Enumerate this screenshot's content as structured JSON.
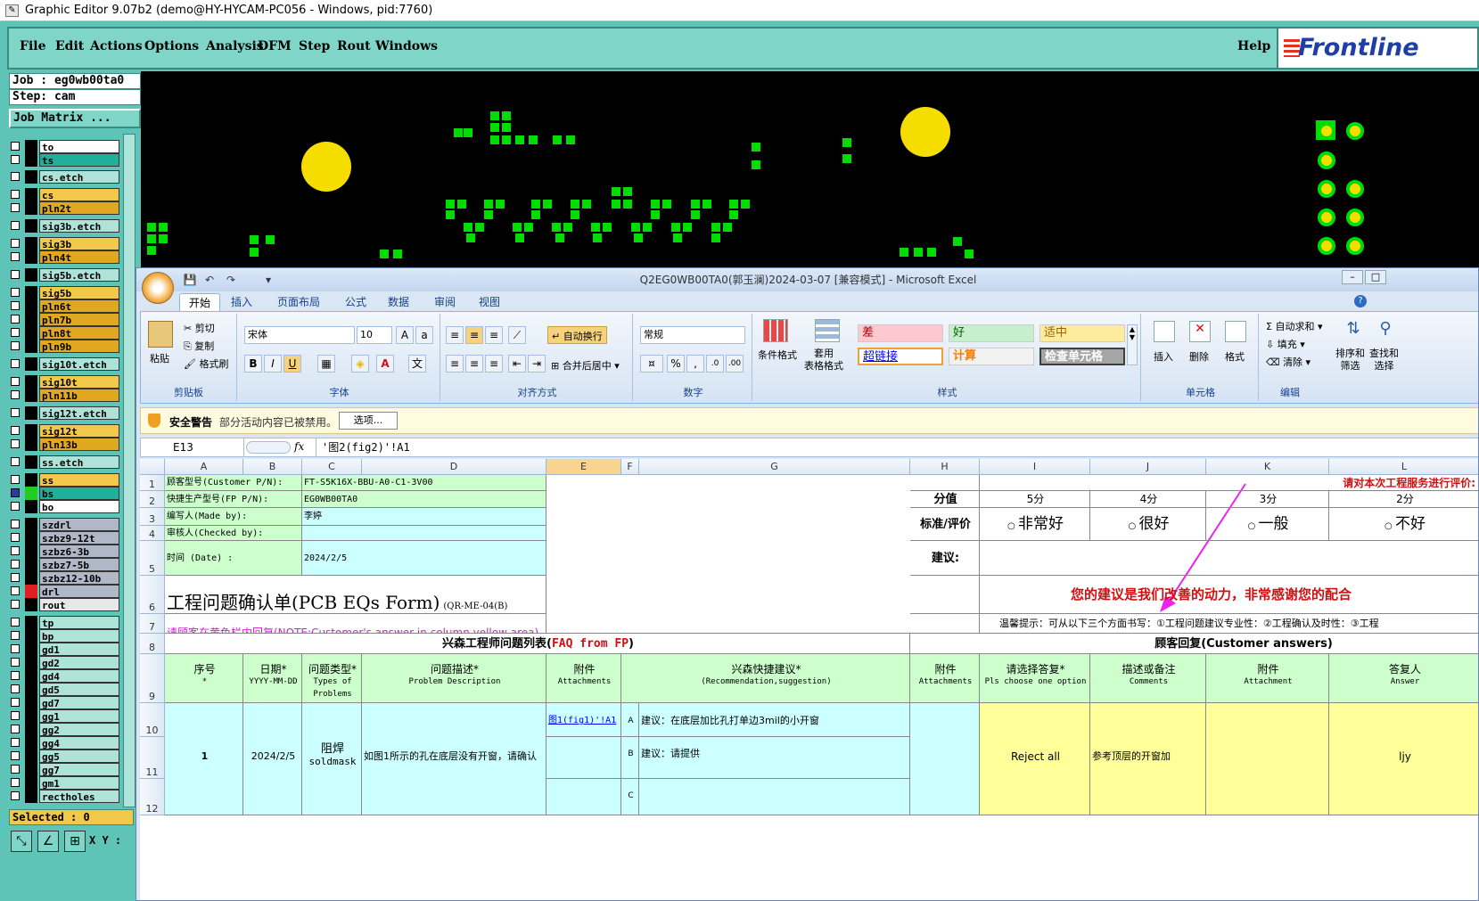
{
  "app": {
    "title": "Graphic Editor 9.07b2 (demo@HY-HYCAM-PC056 - Windows, pid:7760)",
    "logo": "Frontline"
  },
  "menu": [
    "File",
    "Edit",
    "Actions",
    "Options",
    "Analysis",
    "DFM",
    "Step",
    "Rout",
    "Windows"
  ],
  "help": "Help",
  "job": {
    "job": "Job : eg0wb00ta0",
    "step": "Step: cam",
    "matrix_btn": "Job Matrix ..."
  },
  "layers": [
    {
      "name": "to",
      "color": "#ffffff",
      "sw": "#000000"
    },
    {
      "name": "ts",
      "color": "#1fb09c",
      "sw": "#000000"
    },
    {
      "name": "cs.etch",
      "color": "#aee3da",
      "sw": "#000000"
    },
    {
      "name": "cs",
      "color": "#f2c84b",
      "sw": "#000000"
    },
    {
      "name": "pln2t",
      "color": "#e0a820",
      "sw": "#000000"
    },
    {
      "name": "sig3b.etch",
      "color": "#aee3da",
      "sw": "#000000"
    },
    {
      "name": "sig3b",
      "color": "#f2c84b",
      "sw": "#000000"
    },
    {
      "name": "pln4t",
      "color": "#e0a820",
      "sw": "#000000"
    },
    {
      "name": "sig5b.etch",
      "color": "#aee3da",
      "sw": "#000000"
    },
    {
      "name": "sig5b",
      "color": "#f2c84b",
      "sw": "#000000"
    },
    {
      "name": "pln6t",
      "color": "#e0a820",
      "sw": "#000000"
    },
    {
      "name": "pln7b",
      "color": "#e0a820",
      "sw": "#000000"
    },
    {
      "name": "pln8t",
      "color": "#e0a820",
      "sw": "#000000"
    },
    {
      "name": "pln9b",
      "color": "#e0a820",
      "sw": "#000000"
    },
    {
      "name": "sig10t.etch",
      "color": "#aee3da",
      "sw": "#000000"
    },
    {
      "name": "sig10t",
      "color": "#f2c84b",
      "sw": "#000000"
    },
    {
      "name": "pln11b",
      "color": "#e0a820",
      "sw": "#000000"
    },
    {
      "name": "sig12t.etch",
      "color": "#aee3da",
      "sw": "#000000"
    },
    {
      "name": "sig12t",
      "color": "#f2c84b",
      "sw": "#000000"
    },
    {
      "name": "pln13b",
      "color": "#e0a820",
      "sw": "#000000"
    },
    {
      "name": "ss.etch",
      "color": "#aee3da",
      "sw": "#000000"
    },
    {
      "name": "ss",
      "color": "#f2c84b",
      "sw": "#000000"
    },
    {
      "name": "bs",
      "color": "#1fb09c",
      "sw": "#22cc22"
    },
    {
      "name": "bo",
      "color": "#ffffff",
      "sw": "#000000"
    },
    {
      "name": "szdrl",
      "color": "#b0b8c8",
      "sw": "#000000"
    },
    {
      "name": "szbz9-12t",
      "color": "#b0b8c8",
      "sw": "#000000"
    },
    {
      "name": "szbz6-3b",
      "color": "#b0b8c8",
      "sw": "#000000"
    },
    {
      "name": "szbz7-5b",
      "color": "#b0b8c8",
      "sw": "#000000"
    },
    {
      "name": "szbz12-10b",
      "color": "#b0b8c8",
      "sw": "#000000"
    },
    {
      "name": "drl",
      "color": "#b0b8c8",
      "sw": "#e02020"
    },
    {
      "name": "rout",
      "color": "#e8e8e8",
      "sw": "#000000"
    },
    {
      "name": "tp",
      "color": "#aee3da",
      "sw": "#000000"
    },
    {
      "name": "bp",
      "color": "#aee3da",
      "sw": "#000000"
    },
    {
      "name": "gd1",
      "color": "#aee3da",
      "sw": "#000000"
    },
    {
      "name": "gd2",
      "color": "#aee3da",
      "sw": "#000000"
    },
    {
      "name": "gd4",
      "color": "#aee3da",
      "sw": "#000000"
    },
    {
      "name": "gd5",
      "color": "#aee3da",
      "sw": "#000000"
    },
    {
      "name": "gd7",
      "color": "#aee3da",
      "sw": "#000000"
    },
    {
      "name": "gg1",
      "color": "#aee3da",
      "sw": "#000000"
    },
    {
      "name": "gg2",
      "color": "#aee3da",
      "sw": "#000000"
    },
    {
      "name": "gg4",
      "color": "#aee3da",
      "sw": "#000000"
    },
    {
      "name": "gg5",
      "color": "#aee3da",
      "sw": "#000000"
    },
    {
      "name": "gg7",
      "color": "#aee3da",
      "sw": "#000000"
    },
    {
      "name": "gm1",
      "color": "#aee3da",
      "sw": "#000000"
    },
    {
      "name": "rectholes",
      "color": "#aee3da",
      "sw": "#000000"
    }
  ],
  "selected": "Selected : 0",
  "xy": "X Y :",
  "excel": {
    "title": "Q2EG0WB00TA0(郭玉澜)2024-03-07 [兼容模式] - Microsoft Excel",
    "tabs": [
      "开始",
      "插入",
      "页面布局",
      "公式",
      "数据",
      "审阅",
      "视图"
    ],
    "clipboard": {
      "paste": "粘贴",
      "cut": "剪切",
      "copy": "复制",
      "format_painter": "格式刷",
      "label": "剪贴板"
    },
    "font": {
      "name": "宋体",
      "size": "10",
      "label": "字体"
    },
    "align": {
      "wrap": "自动换行",
      "merge": "合并后居中",
      "label": "对齐方式"
    },
    "number": {
      "format": "常规",
      "label": "数字"
    },
    "styles": {
      "cond": "条件格式",
      "table": "套用\n表格格式",
      "bad": "差",
      "good": "好",
      "neutral": "适中",
      "hyperlink": "超链接",
      "calc": "计算",
      "check": "检查单元格",
      "label": "样式"
    },
    "cells": {
      "insert": "插入",
      "delete": "删除",
      "format": "格式",
      "label": "单元格"
    },
    "edit": {
      "autosum": "自动求和",
      "fill": "填充",
      "clear": "清除",
      "sort": "排序和\n筛选",
      "find": "查找和\n选择",
      "label": "编辑"
    },
    "security": {
      "title": "安全警告",
      "msg": "部分活动内容已被禁用。",
      "btn": "选项..."
    },
    "namebox": "E13",
    "formula": "'图2(fig2)'!A1",
    "fx": "fx",
    "cols": [
      "A",
      "B",
      "C",
      "D",
      "E",
      "F",
      "G",
      "H",
      "I",
      "J",
      "K",
      "L"
    ],
    "rows": [
      "1",
      "2",
      "3",
      "4",
      "5",
      "6",
      "7",
      "8",
      "9",
      "10",
      "11",
      "12"
    ],
    "info": [
      {
        "label": "顾客型号(Customer P/N):",
        "value": "FT-S5K16X-BBU-A0-C1-3V00"
      },
      {
        "label": "快捷生产型号(FP P/N):",
        "value": "EG0WB00TA0"
      },
      {
        "label": "编写人(Made by):",
        "value": "李婷"
      },
      {
        "label": "审核人(Checked by):",
        "value": ""
      },
      {
        "label": "时间 (Date) :",
        "value": "2024/2/5"
      }
    ],
    "form_title": "工程问题确认单(PCB EQs Form)",
    "form_code": "(QR-ME-04(B)",
    "note": "请顾客在黄色栏内回复(NOTE:Customer's answer in column yellow area)",
    "rating": {
      "header": "请对本次工程服务进行评价:",
      "score_label": "分值",
      "scores": [
        "5分",
        "4分",
        "3分",
        "2分"
      ],
      "std_label": "标准/评价",
      "opts": [
        "非常好",
        "很好",
        "一般",
        "不好"
      ],
      "suggest": "建议:",
      "thanks": "您的建议是我们改善的动力，非常感谢您的配合",
      "tip": "温馨提示：可从以下三个方面书写：①工程问题建议专业性：②工程确认及时性：③工程"
    },
    "faq_title": "兴森工程师问题列表(",
    "faq_red": "FAQ from FP",
    "cust_title": "顾客回复(Customer answers)",
    "headers": [
      {
        "cn": "序号",
        "en": "*"
      },
      {
        "cn": "日期*",
        "en": "YYYY-MM-DD"
      },
      {
        "cn": "问题类型*",
        "en": "Types of Problems"
      },
      {
        "cn": "问题描述*",
        "en": "Problem Description"
      },
      {
        "cn": "附件",
        "en": "Attachments"
      },
      {
        "cn": "兴森快捷建议*",
        "en": "(Recommendation,suggestion)"
      },
      {
        "cn": "附件",
        "en": "Attachments"
      },
      {
        "cn": "请选择答复*",
        "en": "Pls choose one option"
      },
      {
        "cn": "描述或备注",
        "en": "Comments"
      },
      {
        "cn": "附件",
        "en": "Attachment"
      },
      {
        "cn": "答复人",
        "en": "Answer"
      }
    ],
    "row": {
      "no": "1",
      "date": "2024/2/5",
      "type": "阻焊",
      "type_en": "soldmask",
      "desc": "如图1所示的孔在底层没有开窗，请确认",
      "attach": "图1(fig1)'!A1",
      "sugA": "建议：在底层加比孔打单边3mil的小开窗",
      "sugB": "建议：请提供",
      "letters": [
        "A",
        "B",
        "C"
      ],
      "answer": "Reject all",
      "comment": "参考顶层的开窗加",
      "answerer": "ljy"
    }
  }
}
